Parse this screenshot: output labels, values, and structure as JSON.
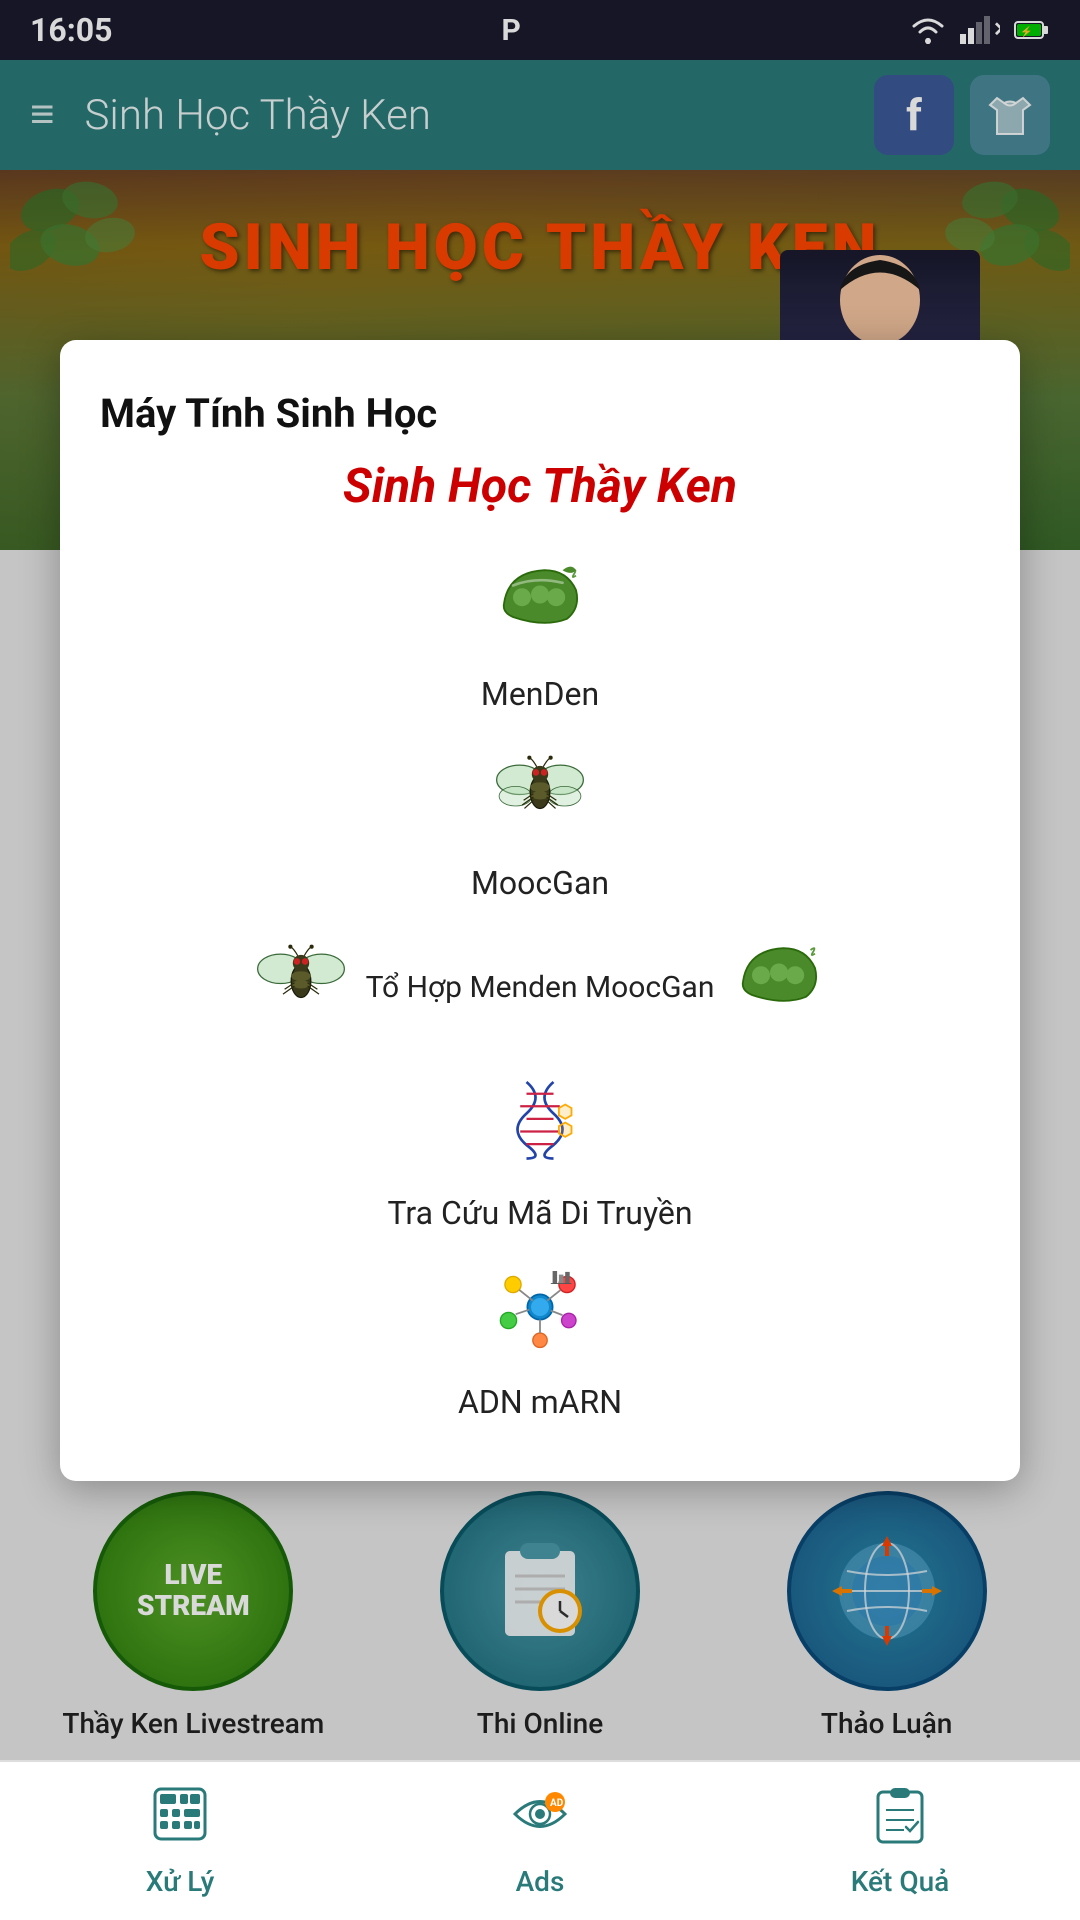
{
  "statusBar": {
    "time": "16:05",
    "parkingIcon": "P",
    "wifiIcon": "wifi",
    "signalIcon": "signal",
    "batteryIcon": "battery"
  },
  "topBar": {
    "title": "Sinh Học Thầy Ken",
    "menuIcon": "≡",
    "facebookLabel": "f",
    "shirtIcon": "👔"
  },
  "banner": {
    "title": "SINH HỌC THẦY KEN",
    "logoText": "KEN"
  },
  "modal": {
    "header": "Máy Tính Sinh Học",
    "subtitle": "Sinh Học Thầy Ken",
    "items": [
      {
        "id": "menden",
        "label": "MenDen",
        "iconType": "pea"
      },
      {
        "id": "moocgan",
        "label": "MoocGan",
        "iconType": "fly"
      },
      {
        "id": "tohop",
        "label": "Tổ Hợp Menden MoocGan",
        "iconType": "flyAndPea"
      },
      {
        "id": "tracuu",
        "label": "Tra Cứu Mã Di Truyền",
        "iconType": "dna"
      },
      {
        "id": "adnmarn",
        "label": "ADN mARN",
        "iconType": "molecule"
      }
    ]
  },
  "backgroundItems": [
    {
      "id": "livestream",
      "label": "Thầy Ken Livestream",
      "iconType": "live"
    },
    {
      "id": "thi",
      "label": "Thi Online",
      "iconType": "thi"
    },
    {
      "id": "thaoluan",
      "label": "Thảo Luận",
      "iconType": "globe"
    }
  ],
  "bottomNav": [
    {
      "id": "xuly",
      "label": "Xử Lý",
      "icon": "📊"
    },
    {
      "id": "ads",
      "label": "Ads",
      "icon": "👁"
    },
    {
      "id": "ketqua",
      "label": "Kết Quả",
      "icon": "📋"
    }
  ]
}
